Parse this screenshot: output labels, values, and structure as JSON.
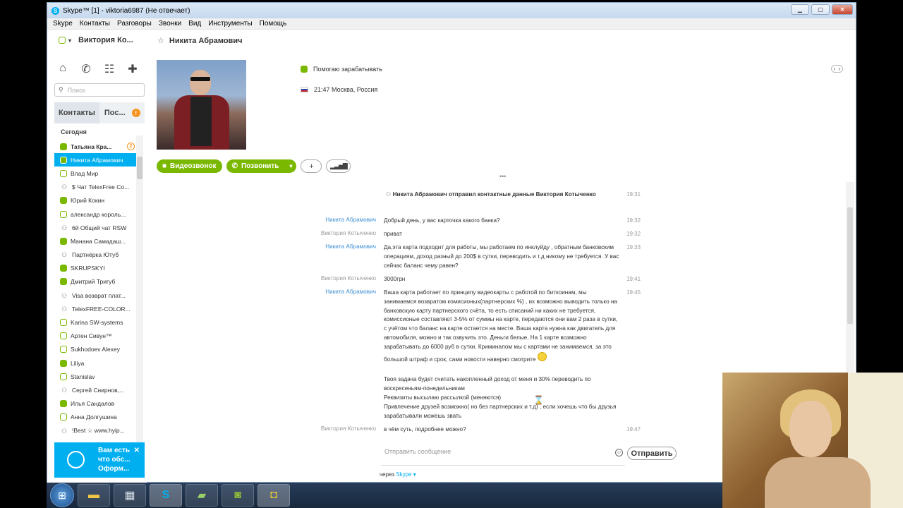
{
  "window": {
    "title": "Skype™ [1] - viktoria6987 (Не отвечает)",
    "minimize": "▁",
    "maximize": "▢",
    "close": "✕"
  },
  "menu": [
    "Skype",
    "Контакты",
    "Разговоры",
    "Звонки",
    "Вид",
    "Инструменты",
    "Помощь"
  ],
  "profile": {
    "name": "Виктория Ко...",
    "status": "away"
  },
  "search": {
    "placeholder": "Поиск"
  },
  "tabs": {
    "contacts": "Контакты",
    "recent": "Пос...",
    "recent_badge": "!"
  },
  "section": "Сегодня",
  "contacts": [
    {
      "name": "Татьяна Кра...",
      "icon": "online",
      "bold": true,
      "count": "2"
    },
    {
      "name": "Никита Абрамович",
      "icon": "online",
      "selected": true
    },
    {
      "name": "Влад  Мир",
      "icon": "offline"
    },
    {
      "name": "$ Чат TelexFree Co...",
      "icon": "group"
    },
    {
      "name": "Юрий   Кокин",
      "icon": "online"
    },
    {
      "name": "александр король...",
      "icon": "offline"
    },
    {
      "name": "6й Общий чат RSW",
      "icon": "group"
    },
    {
      "name": "Манана Самадаш...",
      "icon": "online"
    },
    {
      "name": "Партнёрка Ютуб",
      "icon": "group"
    },
    {
      "name": "SKRUPSKYI",
      "icon": "online"
    },
    {
      "name": "Дмитрий Тригуб",
      "icon": "online"
    },
    {
      "name": "Visa возврат плат...",
      "icon": "group"
    },
    {
      "name": "TelexFREE-COLOR...",
      "icon": "group"
    },
    {
      "name": "Karina SW-systems",
      "icon": "offline"
    },
    {
      "name": "Артен Сивун™",
      "icon": "offline"
    },
    {
      "name": "Sukhodoev Alexey",
      "icon": "offline"
    },
    {
      "name": "Liliya",
      "icon": "online"
    },
    {
      "name": "Stanislav",
      "icon": "offline"
    },
    {
      "name": "Сергей Снирнов,...",
      "icon": "group"
    },
    {
      "name": "Илья Сандалов",
      "icon": "online"
    },
    {
      "name": "Анна Долгушина",
      "icon": "offline"
    },
    {
      "name": "!Best ☆ www.hyip...",
      "icon": "group"
    }
  ],
  "promo": {
    "line1": "Вам есть",
    "line2": "что обс...",
    "line3": "Оформ..."
  },
  "conversation": {
    "name": "Никита Абрамович",
    "mood": "Помогаю зарабатывать",
    "location": "21:47 Москва, Россия",
    "buttons": {
      "video": "Видеозвонок",
      "call": "Позвонить",
      "add": "+"
    }
  },
  "messages": [
    {
      "sender": "",
      "text": "Никита Абрамович отправил контактные данные Виктория Котыченко",
      "time": "19:31"
    },
    {
      "sender": "Никита Абрамович",
      "text": "Добрый день, у вас карточка какого банка?",
      "time": "19:32"
    },
    {
      "sender": "Виктория Котыченко",
      "text": "приват",
      "time": "19:32"
    },
    {
      "sender": "Никита Абрамович",
      "text": "Да,эта карта подходит для работы, мы работаем по инклуйду , обратным банковским операциям, доход разный до 200$ в сутки, переводить и т.д никому не требуется. У вас сейчас баланс чему равен?",
      "time": "19:33"
    },
    {
      "sender": "Виктория Котыченко",
      "text": "3000грн",
      "time": "19:41"
    },
    {
      "sender": "Никита Абрамович",
      "text": "Ваша карта работает по принципу видеокарты с работой по биткоинам, мы занимаемся возвратом комисионых(партнерских %) , их возможно выводить только на банковскую карту партнерского счёта, то есть списаний ни каких не требуется, комиссионые составляют 3-5% от суммы на карте, передаются они вам 2 раза в сутки, с учётом что баланс на карте остается на месте. Ваша карта нужна как двигатель для автомобиля, можно и так озвучить это. Деньги белые, На 1 карте возможно зарабатывать до 6000 руб в сутки. Криминалом мы с картами не занимаемся, за это большой штраф и срок, сами новости наверно смотрите",
      "time": "19:45"
    },
    {
      "sender": "",
      "text": "Твоя задача будет считать накопленный доход от меня и 30% переводить по воскресеньям-понедельникам",
      "time": ""
    },
    {
      "sender": "",
      "text": "Реквизиты высылаю рассылкой (меняются)",
      "time": ""
    },
    {
      "sender": "",
      "text": "Привлечение друзей возможно( но без партнерских и т.д) , если хочешь что бы друзья зарабатывали можешь звать",
      "time": ""
    },
    {
      "sender": "Виктория Котыченко",
      "text": "в чём суть, подробнее можно?",
      "time": "19:47"
    }
  ],
  "compose": {
    "placeholder": "Отправить сообщение",
    "send": "Отправить",
    "via_prefix": "через",
    "via_link": "Skype ▾"
  },
  "colors": {
    "skype_blue": "#00aff0",
    "online_green": "#7ab800",
    "badge_orange": "#f7931e"
  }
}
